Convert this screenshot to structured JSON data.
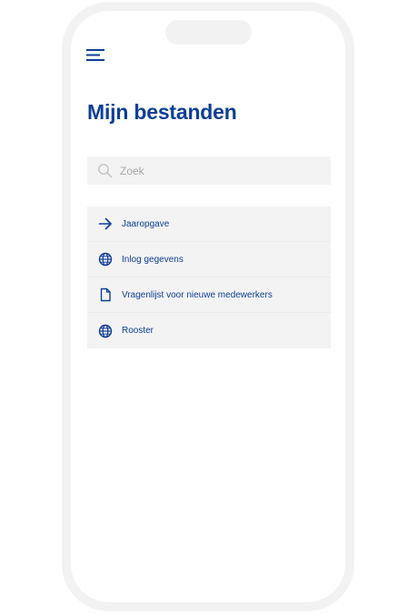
{
  "header": {
    "menu_icon": "hamburger-menu-icon",
    "title": "Mijn bestanden"
  },
  "search": {
    "icon": "search-icon",
    "placeholder": "Zoek",
    "value": ""
  },
  "files": [
    {
      "label": "Jaaropgave",
      "icon": "arrow-right-icon"
    },
    {
      "label": "Inlog gegevens",
      "icon": "globe-icon"
    },
    {
      "label": "Vragenlijst voor nieuwe medewerkers",
      "icon": "document-icon"
    },
    {
      "label": "Rooster",
      "icon": "globe-icon"
    }
  ],
  "colors": {
    "primary": "#0d3e96",
    "panel_bg": "#f3f3f4",
    "frame": "#f2f2f3",
    "placeholder": "#a6a6a6"
  }
}
